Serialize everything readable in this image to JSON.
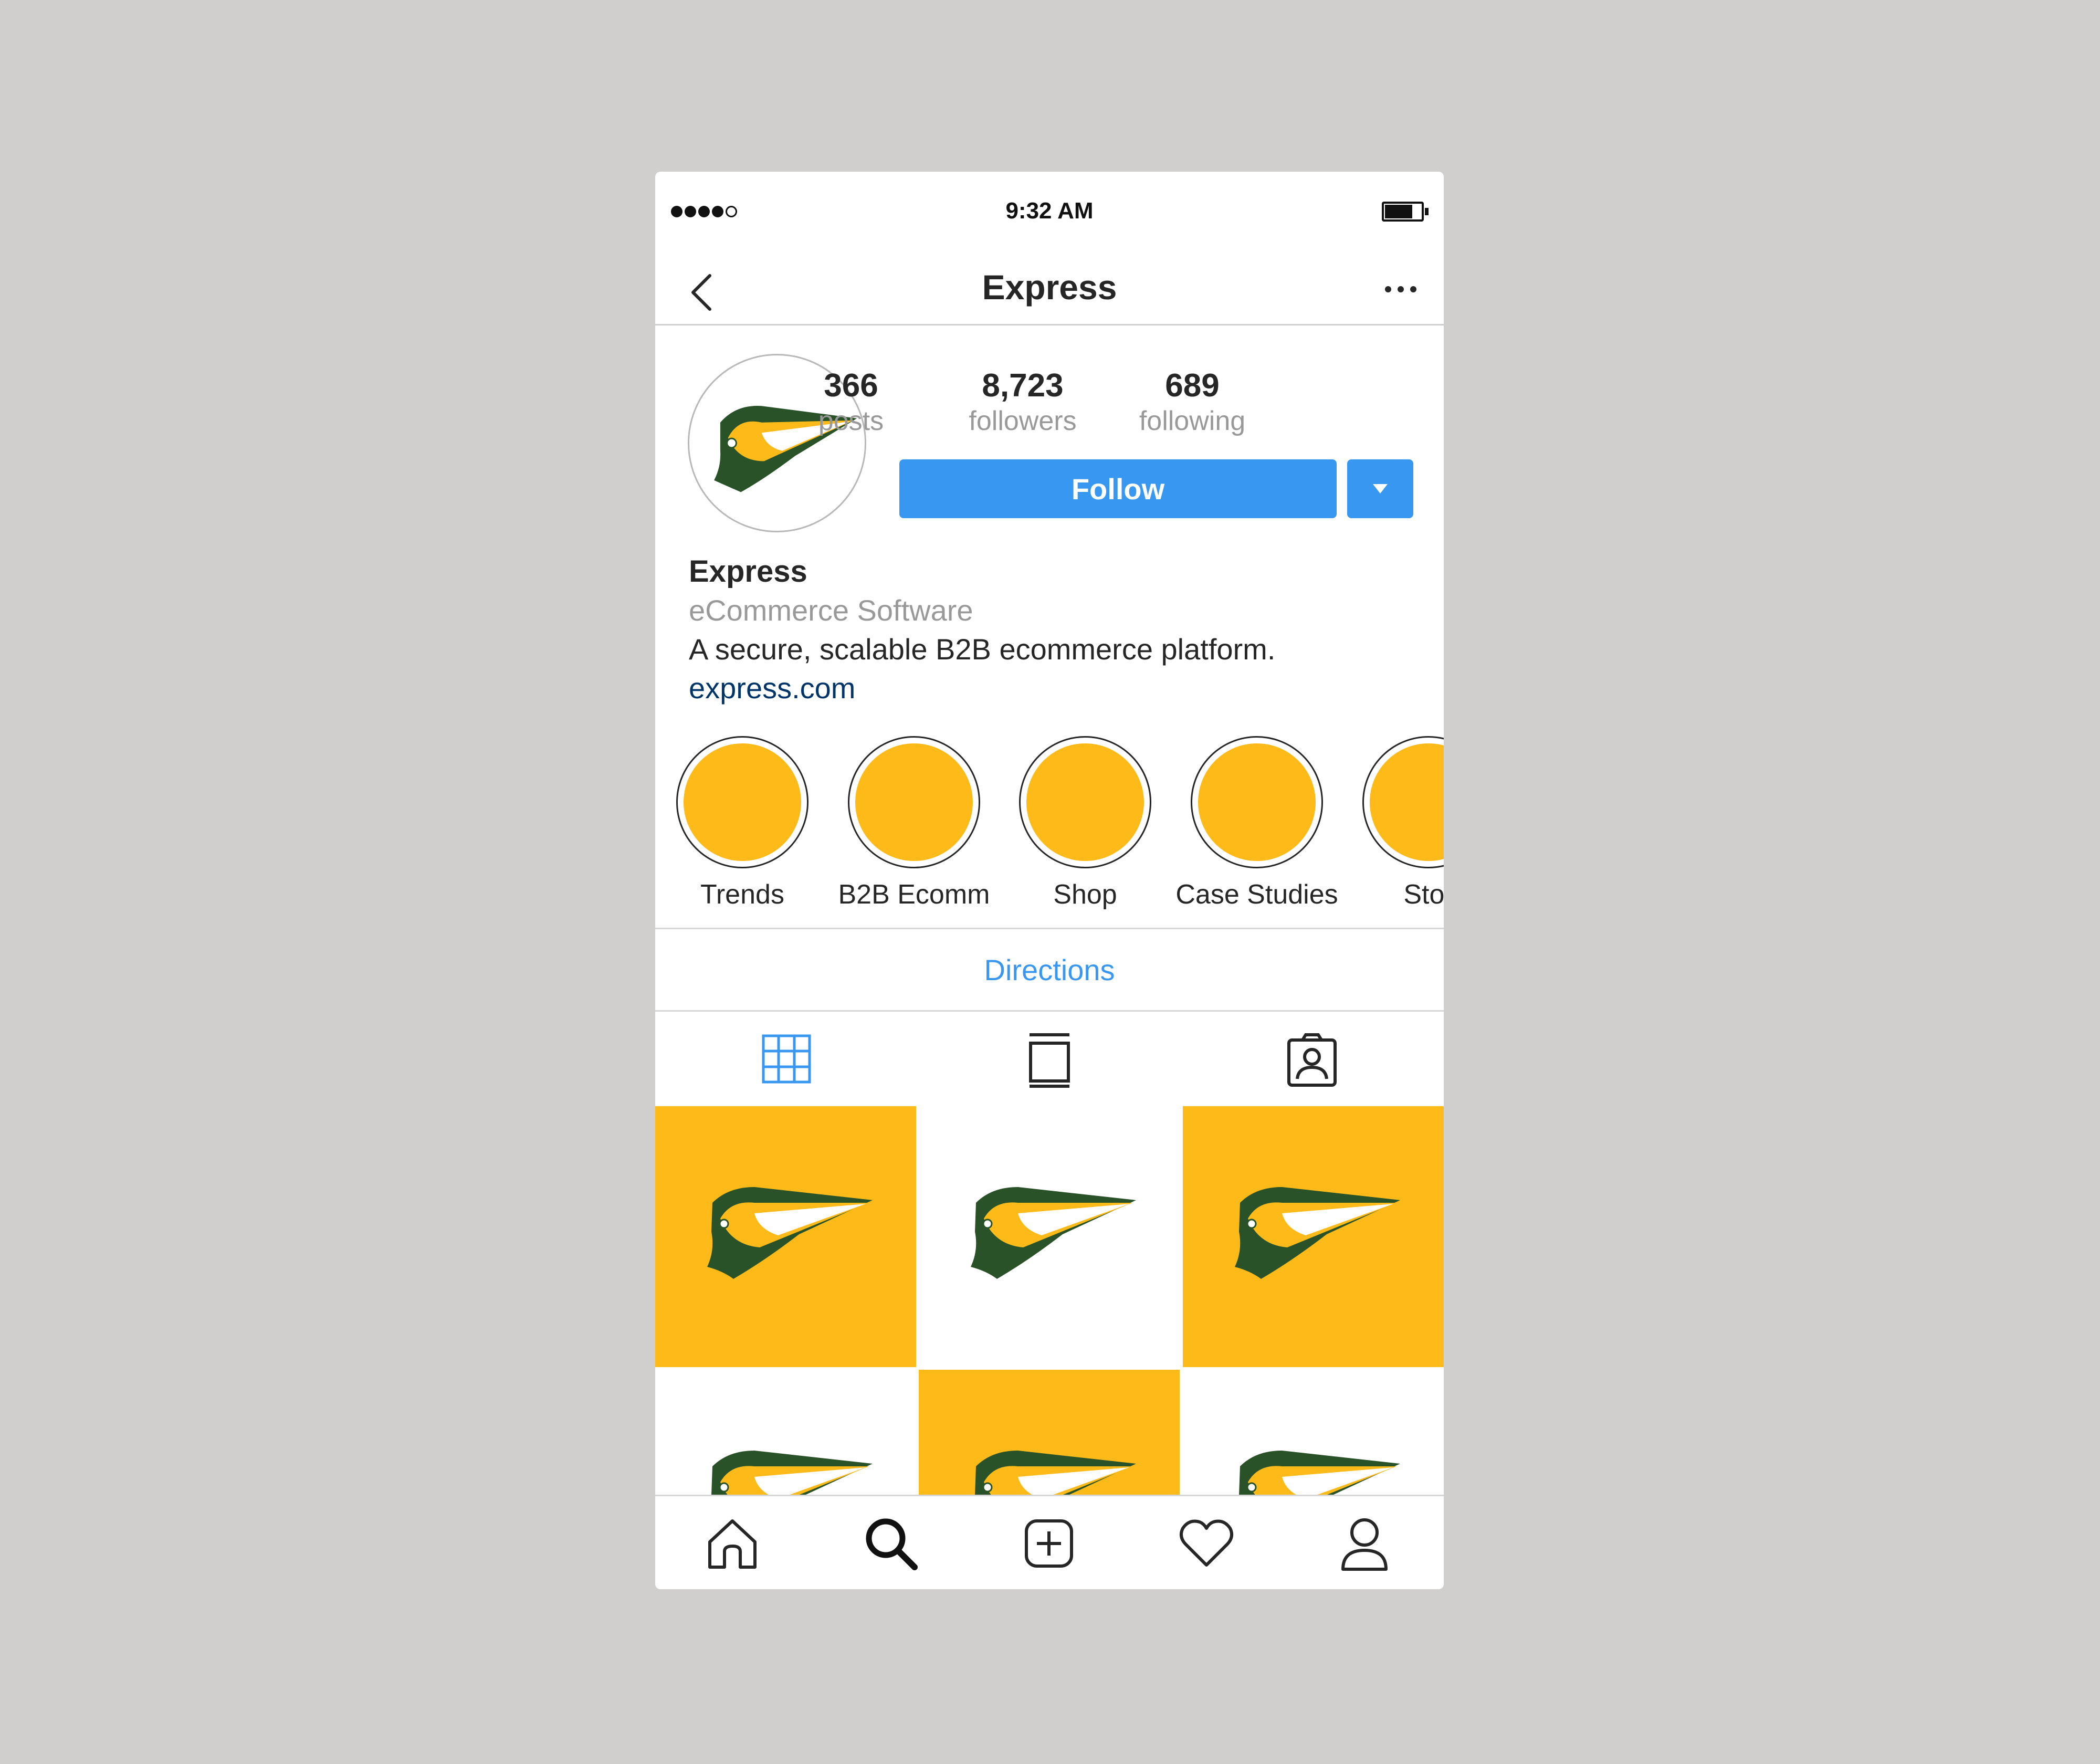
{
  "status_bar": {
    "time": "9:32 AM",
    "signal_icon": "signal-dots-icon",
    "battery_icon": "battery-icon"
  },
  "nav": {
    "title": "Express",
    "back_icon": "chevron-left-icon",
    "more_icon": "more-horizontal-icon"
  },
  "profile": {
    "avatar_icon": "express-logo-icon",
    "stats": [
      {
        "value": "366",
        "label": "posts"
      },
      {
        "value": "8,723",
        "label": "followers"
      },
      {
        "value": "689",
        "label": "following"
      }
    ],
    "follow_label": "Follow",
    "dropdown_icon": "caret-down-icon"
  },
  "bio": {
    "name": "Express",
    "category": "eCommerce Software",
    "text": "A secure, scalable B2B ecommerce platform.",
    "link": "express.com"
  },
  "highlights": [
    {
      "label": "Trends"
    },
    {
      "label": "B2B Ecomm"
    },
    {
      "label": "Shop"
    },
    {
      "label": "Case Studies"
    },
    {
      "label": "Stor"
    }
  ],
  "directions_label": "Directions",
  "tabs": [
    "grid-icon",
    "list-icon",
    "tagged-icon"
  ],
  "bottom_nav": [
    "home-icon",
    "search-icon",
    "add-post-icon",
    "heart-icon",
    "profile-icon"
  ],
  "colors": {
    "brand_yellow": "#fdba19",
    "brand_green": "#2a5228",
    "accent_blue": "#3897f0",
    "link_navy": "#003569",
    "background": "#d0cfcd"
  }
}
